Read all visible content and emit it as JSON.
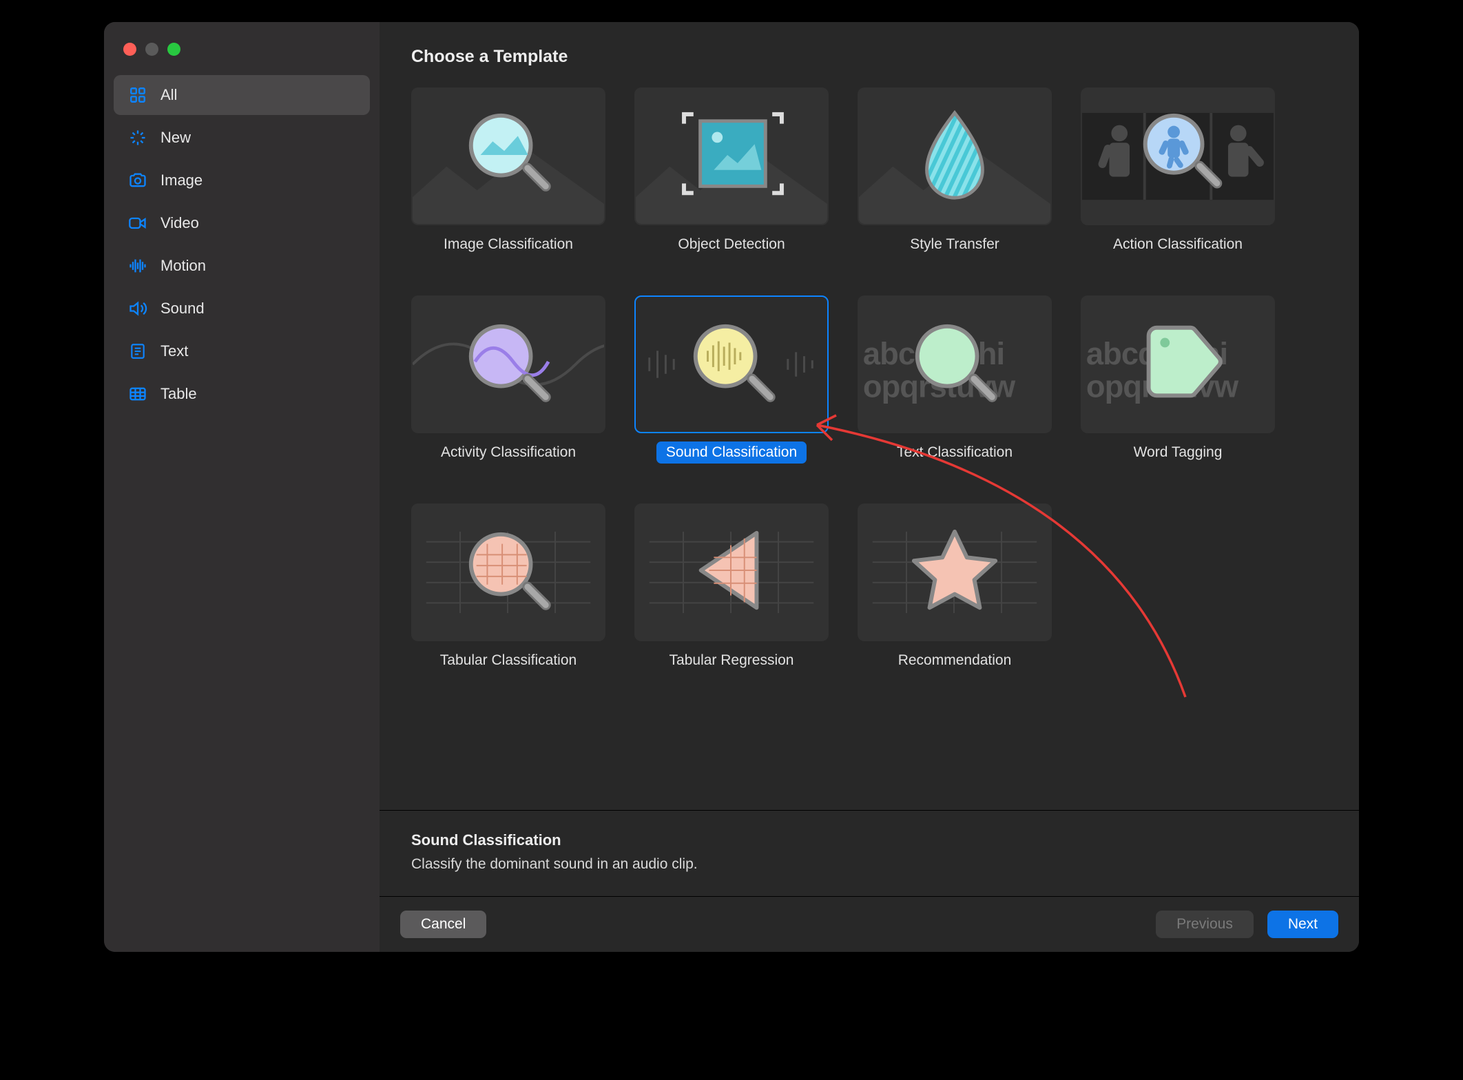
{
  "header": {
    "title": "Choose a Template"
  },
  "sidebar": {
    "items": [
      {
        "id": "all",
        "label": "All",
        "selected": true
      },
      {
        "id": "new",
        "label": "New",
        "selected": false
      },
      {
        "id": "image",
        "label": "Image",
        "selected": false
      },
      {
        "id": "video",
        "label": "Video",
        "selected": false
      },
      {
        "id": "motion",
        "label": "Motion",
        "selected": false
      },
      {
        "id": "sound",
        "label": "Sound",
        "selected": false
      },
      {
        "id": "text",
        "label": "Text",
        "selected": false
      },
      {
        "id": "table",
        "label": "Table",
        "selected": false
      }
    ]
  },
  "templates": [
    {
      "id": "image-classification",
      "label": "Image Classification",
      "selected": false
    },
    {
      "id": "object-detection",
      "label": "Object Detection",
      "selected": false
    },
    {
      "id": "style-transfer",
      "label": "Style Transfer",
      "selected": false
    },
    {
      "id": "action-classification",
      "label": "Action Classification",
      "selected": false
    },
    {
      "id": "activity-classification",
      "label": "Activity Classification",
      "selected": false
    },
    {
      "id": "sound-classification",
      "label": "Sound Classification",
      "selected": true
    },
    {
      "id": "text-classification",
      "label": "Text Classification",
      "selected": false
    },
    {
      "id": "word-tagging",
      "label": "Word Tagging",
      "selected": false
    },
    {
      "id": "tabular-classification",
      "label": "Tabular Classification",
      "selected": false
    },
    {
      "id": "tabular-regression",
      "label": "Tabular Regression",
      "selected": false
    },
    {
      "id": "recommendation",
      "label": "Recommendation",
      "selected": false
    }
  ],
  "description": {
    "title": "Sound Classification",
    "text": "Classify the dominant sound in an audio clip."
  },
  "buttons": {
    "cancel": "Cancel",
    "previous": "Previous",
    "next": "Next"
  },
  "bg_text": {
    "line1": "abcdefghi",
    "line2": "opqrstuvw"
  }
}
